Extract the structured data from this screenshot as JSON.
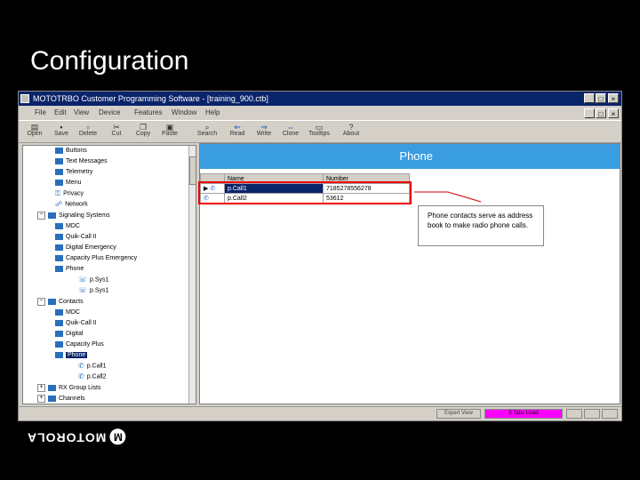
{
  "slide": {
    "title": "Configuration"
  },
  "window": {
    "title": "MOTOTRBO Customer Programming Software - [training_900.ctb]",
    "controls": {
      "minimize": "_",
      "maximize": "□",
      "close": "×"
    },
    "mdi_controls": {
      "minimize": "_",
      "restore": "□",
      "close": "×"
    }
  },
  "menu": [
    "File",
    "Edit",
    "View",
    "Device",
    "Features",
    "Window",
    "Help"
  ],
  "toolbar": [
    {
      "label": "Open",
      "icon": "open-icon"
    },
    {
      "label": "Save",
      "icon": "save-icon"
    },
    {
      "label": "Delete",
      "icon": "delete-icon"
    },
    {
      "label": "Cut",
      "icon": "cut-icon"
    },
    {
      "label": "Copy",
      "icon": "copy-icon"
    },
    {
      "label": "Paste",
      "icon": "paste-icon"
    },
    {
      "label": "Search",
      "icon": "search-icon"
    },
    {
      "label": "Read",
      "icon": "read-icon"
    },
    {
      "label": "Write",
      "icon": "write-icon"
    },
    {
      "label": "Clone",
      "icon": "clone-icon"
    },
    {
      "label": "Tooltips",
      "icon": "tooltips-icon"
    },
    {
      "label": "About",
      "icon": "about-icon"
    }
  ],
  "tree": [
    {
      "label": "Buttons"
    },
    {
      "label": "Text Messages"
    },
    {
      "label": "Telemetry"
    },
    {
      "label": "Menu"
    },
    {
      "label": "Privacy"
    },
    {
      "label": "Network"
    },
    {
      "label": "Signaling Systems",
      "expander": "−"
    },
    {
      "label": "MDC"
    },
    {
      "label": "Quik-Call II"
    },
    {
      "label": "Digital Emergency"
    },
    {
      "label": "Capacity Plus Emergency"
    },
    {
      "label": "Phone"
    },
    {
      "label": "p.Sys1"
    },
    {
      "label": "p.Sys1"
    },
    {
      "label": "Contacts",
      "expander": "−"
    },
    {
      "label": "MDC"
    },
    {
      "label": "Quik-Call II"
    },
    {
      "label": "Digital"
    },
    {
      "label": "Capacity Plus"
    },
    {
      "label": "Phone"
    },
    {
      "label": "p.Call1"
    },
    {
      "label": "p.Call2"
    },
    {
      "label": "RX Group Lists",
      "expander": "+"
    },
    {
      "label": "Channels",
      "expander": "+"
    }
  ],
  "panel": {
    "header": "Phone",
    "columns": [
      "",
      "Name",
      "Number"
    ],
    "rows": [
      {
        "indicator": "▶",
        "name": "p.Call1",
        "number": "7185278556278"
      },
      {
        "indicator": "",
        "name": "p.Call2",
        "number": "53612"
      }
    ]
  },
  "callout": {
    "text": "Phone contacts serve as address book to make radio phone calls."
  },
  "status": {
    "cell1": "Expert View",
    "cell2": "5 Tabs Used"
  },
  "logo": {
    "text": "MOTOROLA",
    "mark": "M"
  },
  "colors": {
    "header_blue": "#3a9de0",
    "titlebar": "#0a246a",
    "highlight_red": "#ee0000",
    "status_magenta": "#ff00ff"
  }
}
